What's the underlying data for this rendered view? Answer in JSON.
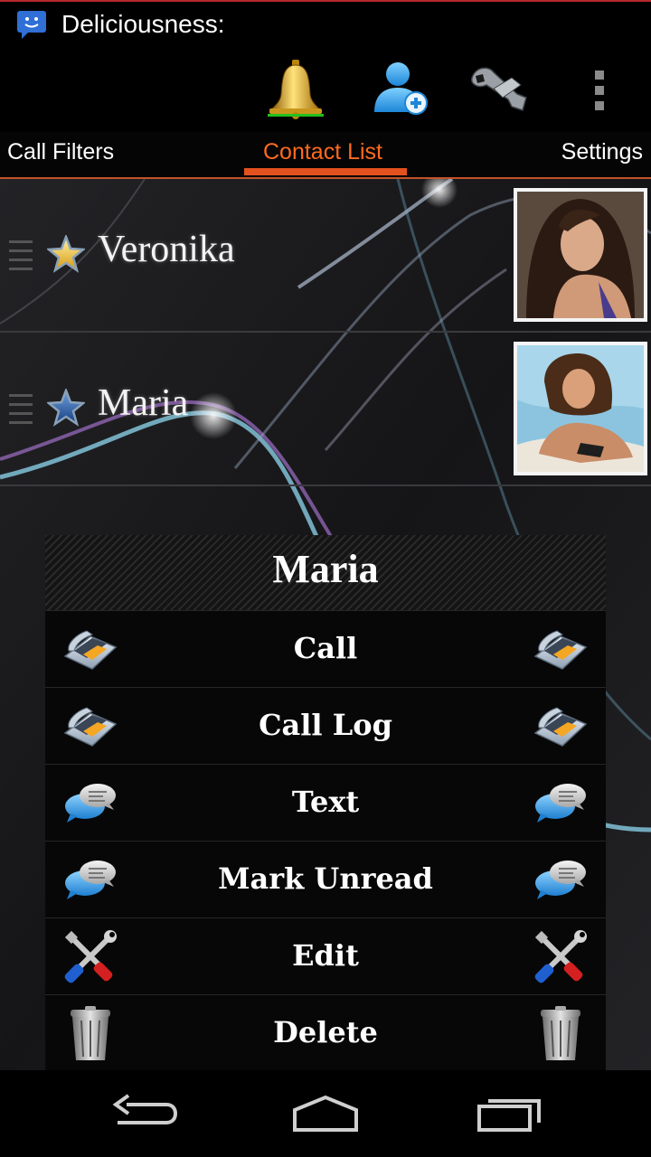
{
  "status_bar": {
    "notification_text": "Deliciousness:"
  },
  "action_bar": {
    "icons": [
      "bell-icon",
      "add-contact-icon",
      "wrench-icon",
      "overflow-menu-icon"
    ]
  },
  "tabs": [
    {
      "label": "Call Filters",
      "active": false
    },
    {
      "label": "Contact List",
      "active": true
    },
    {
      "label": "Settings",
      "active": false
    }
  ],
  "contacts": [
    {
      "name": "Veronika",
      "star": "gold"
    },
    {
      "name": "Maria",
      "star": "blue"
    }
  ],
  "dialog": {
    "title": "Maria",
    "items": [
      {
        "label": "Call",
        "icon": "phone-icon"
      },
      {
        "label": "Call Log",
        "icon": "phone-icon"
      },
      {
        "label": "Text",
        "icon": "chat-bubbles-icon"
      },
      {
        "label": "Mark Unread",
        "icon": "chat-bubbles-icon"
      },
      {
        "label": "Edit",
        "icon": "tools-icon"
      },
      {
        "label": "Delete",
        "icon": "trash-icon"
      }
    ]
  },
  "colors": {
    "accent": "#e3511f",
    "active_tab_text": "#ff6a1f",
    "bell_indicator": "#22c020",
    "status_bar_top_line": "#b5282a"
  }
}
